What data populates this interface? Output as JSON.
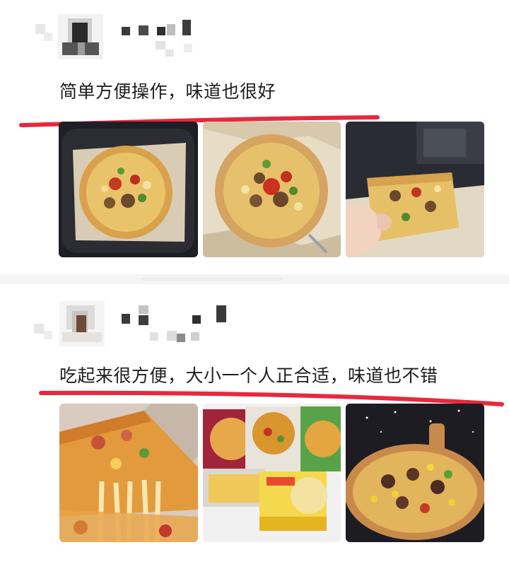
{
  "reviews": [
    {
      "comment": "简单方便操作，味道也很好",
      "photos": [
        {
          "icon": "pizza-in-air-fryer-photo"
        },
        {
          "icon": "whole-pizza-photo"
        },
        {
          "icon": "pizza-slices-in-hand-photo"
        }
      ]
    },
    {
      "comment": "吃起来很方便，大小一个人正合适，味道也不错",
      "photos": [
        {
          "icon": "cheese-pull-slice-photo"
        },
        {
          "icon": "pizza-boxes-photo"
        },
        {
          "icon": "pizza-on-board-photo"
        }
      ]
    }
  ],
  "colors": {
    "underline": "#e8283c",
    "text": "#1e1e1e",
    "separator": "#f5f5f5"
  }
}
